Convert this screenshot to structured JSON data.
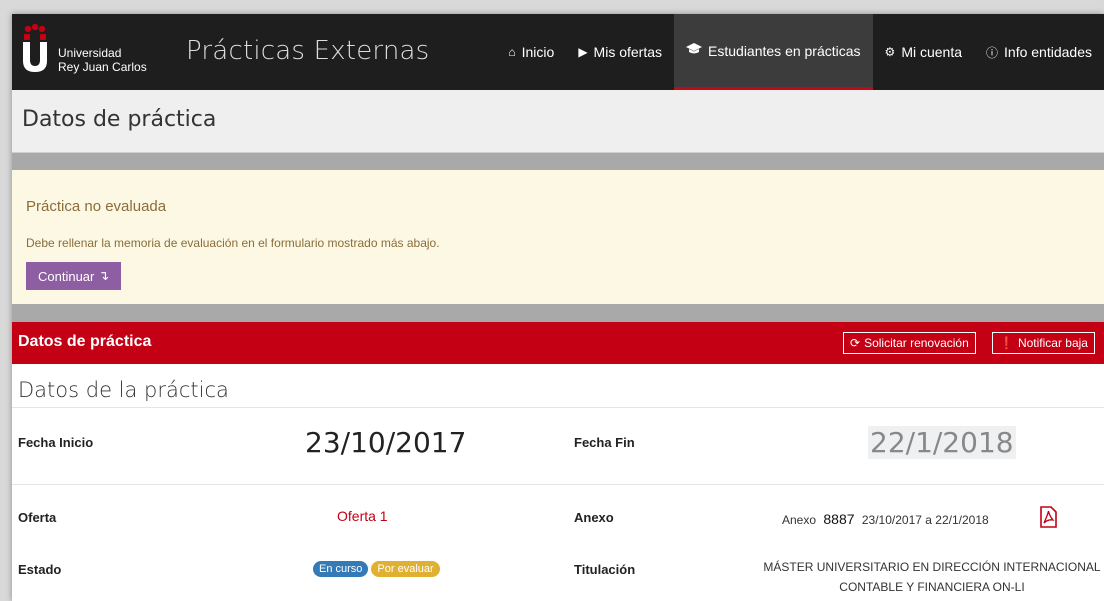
{
  "colors": {
    "navbar_bg": "#1e1e1e",
    "accent_red": "#c30014",
    "alert_bg": "#fcf8e3",
    "button_purple": "#8e5ea2",
    "badge_blue": "#337ab7",
    "badge_yellow": "#f0ad4e"
  },
  "navbar": {
    "logo_line1": "Universidad",
    "logo_line2": "Rey Juan Carlos",
    "brand": "Prácticas Externas",
    "items": [
      {
        "label": "Inicio",
        "icon": "home-icon"
      },
      {
        "label": "Mis ofertas",
        "icon": "tag-icon"
      },
      {
        "label": "Estudiantes en prácticas",
        "icon": "graduation-cap-icon",
        "active": true
      },
      {
        "label": "Mi cuenta",
        "icon": "gears-icon"
      },
      {
        "label": "Info entidades",
        "icon": "info-circle-icon"
      }
    ]
  },
  "page": {
    "title": "Datos de práctica"
  },
  "alert": {
    "title": "Práctica no evaluada",
    "text": "Debe rellenar la memoria de evaluación en el formulario mostrado más abajo.",
    "button": "Continuar"
  },
  "panel": {
    "title": "Datos de práctica",
    "renew_button": "Solicitar renovación",
    "drop_button": "Notificar baja"
  },
  "section": {
    "title": "Datos de la práctica",
    "fecha_inicio_label": "Fecha Inicio",
    "fecha_inicio": "23/10/2017",
    "fecha_fin_label": "Fecha Fin",
    "fecha_fin": "22/1/2018",
    "oferta_label": "Oferta",
    "oferta_value": "Oferta 1",
    "anexo_label": "Anexo",
    "anexo_prefix": "Anexo",
    "anexo_number": "8887",
    "anexo_range": "23/10/2017 a 22/1/2018",
    "estado_label": "Estado",
    "estado_badges": [
      "En curso",
      "Por evaluar"
    ],
    "titulacion_label": "Titulación",
    "titulacion_line1": "MÁSTER UNIVERSITARIO EN DIRECCIÓN INTERNACIONAL",
    "titulacion_line2": "CONTABLE Y FINANCIERA ON-LI"
  }
}
